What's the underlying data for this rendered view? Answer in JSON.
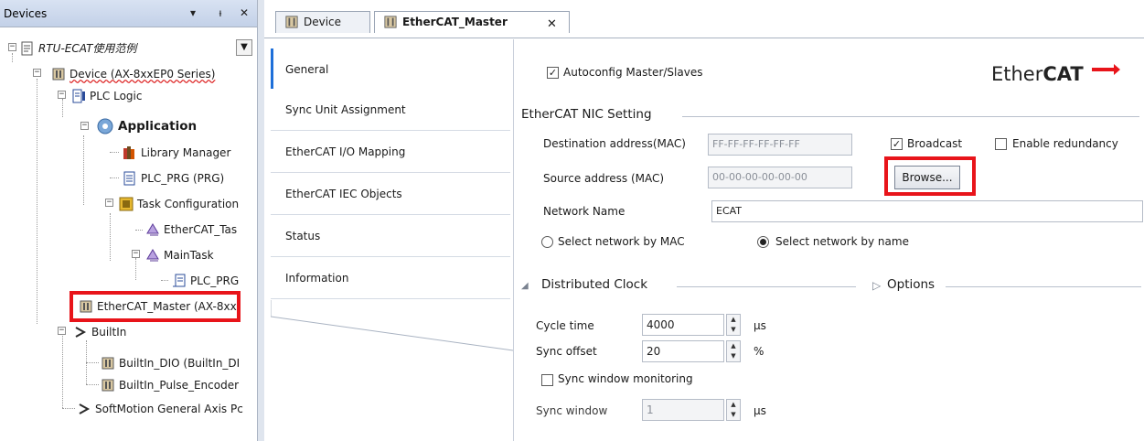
{
  "devices_pane": {
    "title": "Devices",
    "header_buttons": [
      "▾",
      "ᵼ",
      "✕"
    ],
    "tree": [
      {
        "label": "RTU-ECAT使用范例"
      },
      {
        "label": "Device (AX-8xxEP0 Series)"
      },
      {
        "label": "PLC Logic"
      },
      {
        "label": "Application"
      },
      {
        "label": "Library Manager"
      },
      {
        "label": "PLC_PRG (PRG)"
      },
      {
        "label": "Task Configuration"
      },
      {
        "label": "EtherCAT_Tas"
      },
      {
        "label": "MainTask"
      },
      {
        "label": "PLC_PRG"
      },
      {
        "label": "EtherCAT_Master (AX-8xx"
      },
      {
        "label": "BuiltIn"
      },
      {
        "label": "BuiltIn_DIO (BuiltIn_DI"
      },
      {
        "label": "BuiltIn_Pulse_Encoder"
      },
      {
        "label": "SoftMotion General Axis Pc"
      }
    ]
  },
  "tabs": [
    {
      "label": "Device"
    },
    {
      "label": "EtherCAT_Master"
    }
  ],
  "close_glyph": "✕",
  "sidenav": [
    {
      "label": "General"
    },
    {
      "label": "Sync Unit Assignment"
    },
    {
      "label": "EtherCAT I/O Mapping"
    },
    {
      "label": "EtherCAT IEC Objects"
    },
    {
      "label": "Status"
    },
    {
      "label": "Information"
    }
  ],
  "general": {
    "autoconfig_label": "Autoconfig Master/Slaves",
    "logo_text_plain": "Ether",
    "logo_text_bold": "CAT",
    "nic_section": "EtherCAT NIC Setting",
    "dest_label": "Destination address(MAC)",
    "dest_value": "FF-FF-FF-FF-FF-FF",
    "broadcast_label": "Broadcast",
    "redundancy_label": "Enable redundancy",
    "source_label": "Source address (MAC)",
    "source_value": "00-00-00-00-00-00",
    "browse_label": "Browse...",
    "network_name_label": "Network Name",
    "network_name_value": "ECAT",
    "radio_mac_label": "Select network by MAC",
    "radio_name_label": "Select network by name",
    "dc_section": "Distributed Clock",
    "options_section": "Options",
    "cycle_time_label": "Cycle time",
    "cycle_time_value": "4000",
    "cycle_time_unit": "µs",
    "sync_offset_label": "Sync offset",
    "sync_offset_value": "20",
    "sync_offset_unit": "%",
    "sync_window_monitoring_label": "Sync window monitoring",
    "sync_window_label": "Sync window",
    "sync_window_value": "1",
    "sync_window_unit": "µs"
  },
  "colors": {
    "highlight_box": "#e8141a",
    "header_bg": "#c3d1e8"
  }
}
